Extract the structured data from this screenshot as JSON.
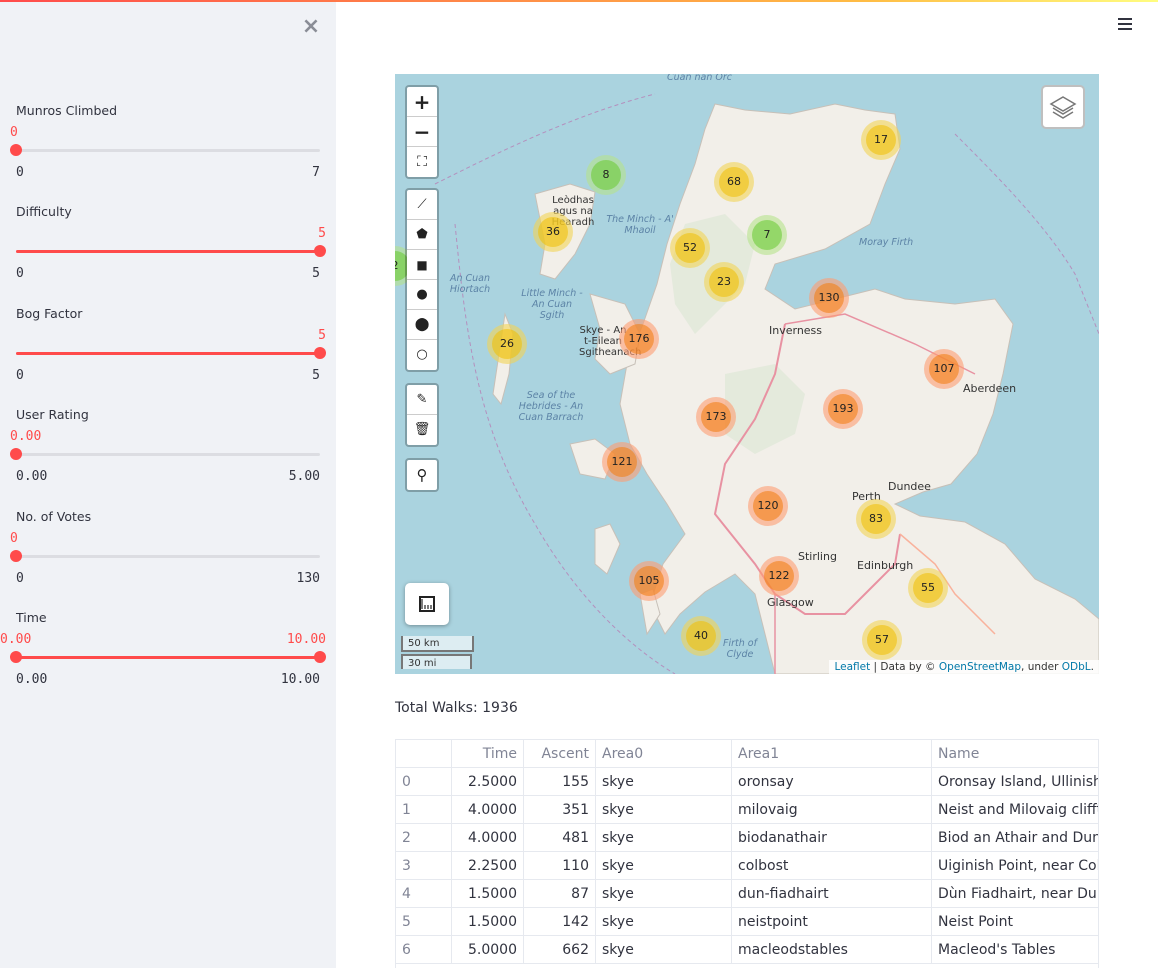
{
  "sidebar": {
    "sliders": [
      {
        "label": "Munros Climbed",
        "value": "0",
        "min": "0",
        "max": "7",
        "low": 0,
        "high": 0
      },
      {
        "label": "Difficulty",
        "value": "5",
        "min": "0",
        "max": "5",
        "low": 0,
        "high": 1
      },
      {
        "label": "Bog Factor",
        "value": "5",
        "min": "0",
        "max": "5",
        "low": 0,
        "high": 1
      },
      {
        "label": "User Rating",
        "value": "0.00",
        "min": "0.00",
        "max": "5.00",
        "low": 0,
        "high": 0
      },
      {
        "label": "No. of Votes",
        "value": "0",
        "min": "0",
        "max": "130",
        "low": 0,
        "high": 0
      },
      {
        "label": "Time",
        "value": "0.00",
        "value2": "10.00",
        "min": "0.00",
        "max": "10.00",
        "low": 0,
        "high": 1
      }
    ]
  },
  "map": {
    "clusters": [
      {
        "count": "17",
        "size": "med"
      },
      {
        "count": "8",
        "size": "small"
      },
      {
        "count": "68",
        "size": "med"
      },
      {
        "count": "36",
        "size": "med"
      },
      {
        "count": "7",
        "size": "small"
      },
      {
        "count": "52",
        "size": "med"
      },
      {
        "count": "2",
        "size": "small"
      },
      {
        "count": "23",
        "size": "med"
      },
      {
        "count": "130",
        "size": "large"
      },
      {
        "count": "26",
        "size": "med"
      },
      {
        "count": "176",
        "size": "large"
      },
      {
        "count": "107",
        "size": "large"
      },
      {
        "count": "193",
        "size": "large"
      },
      {
        "count": "173",
        "size": "large"
      },
      {
        "count": "121",
        "size": "large"
      },
      {
        "count": "120",
        "size": "large"
      },
      {
        "count": "83",
        "size": "med"
      },
      {
        "count": "105",
        "size": "large"
      },
      {
        "count": "122",
        "size": "large"
      },
      {
        "count": "55",
        "size": "med"
      },
      {
        "count": "40",
        "size": "med"
      },
      {
        "count": "57",
        "size": "med"
      }
    ],
    "places": [
      {
        "name": "Inverness"
      },
      {
        "name": "Aberdeen"
      },
      {
        "name": "Perth"
      },
      {
        "name": "Dundee"
      },
      {
        "name": "Stirling"
      },
      {
        "name": "Edinburgh"
      },
      {
        "name": "Glasgow"
      }
    ],
    "water_labels": {
      "minch": "The Minch - A' Mhaoil",
      "moray": "Moray Firth",
      "little_minch": "Little Minch - An Cuan Sgith",
      "hebrides": "Sea of the Hebrides - An Cuan Barrach",
      "clyde": "Firth of Clyde",
      "cuan_orc": "Cuan nan Orc",
      "cuan_hiortach": "An Cuan Hiortach"
    },
    "island_labels": {
      "lewis": "Leòdhas agus na Hearadh",
      "skye": "Skye - An t-Eilean Sgitheanach"
    },
    "zoom_in": "+",
    "zoom_out": "−",
    "scale_km": "50 km",
    "scale_mi": "30 mi",
    "attribution": {
      "leaflet": "Leaflet",
      "data_by": " | Data by © ",
      "osm": "OpenStreetMap",
      "under": ", under ",
      "odbl": "ODbL",
      "period": "."
    },
    "colors": {
      "water": "#aad3df",
      "land": "#f2efe9",
      "cluster_small": "#6ecc39",
      "cluster_medium": "#f0c20c",
      "cluster_large": "#f18017"
    }
  },
  "total_walks": "Total Walks: 1936",
  "table": {
    "columns": [
      "",
      "Time",
      "Ascent",
      "Area0",
      "Area1",
      "Name"
    ],
    "rows": [
      [
        "0",
        "2.5000",
        "155",
        "skye",
        "oronsay",
        "Oronsay Island, Ullinish"
      ],
      [
        "1",
        "4.0000",
        "351",
        "skye",
        "milovaig",
        "Neist and Milovaig clifftop"
      ],
      [
        "2",
        "4.0000",
        "481",
        "skye",
        "biodanathair",
        "Biod an Athair and Dunvegan"
      ],
      [
        "3",
        "2.2500",
        "110",
        "skye",
        "colbost",
        "Uiginish Point, near Colbost"
      ],
      [
        "4",
        "1.5000",
        "87",
        "skye",
        "dun-fiadhairt",
        "Dùn Fiadhairt, near Dunvegan"
      ],
      [
        "5",
        "1.5000",
        "142",
        "skye",
        "neistpoint",
        "Neist Point"
      ],
      [
        "6",
        "5.0000",
        "662",
        "skye",
        "macleodstables",
        "Macleod's Tables"
      ]
    ]
  }
}
